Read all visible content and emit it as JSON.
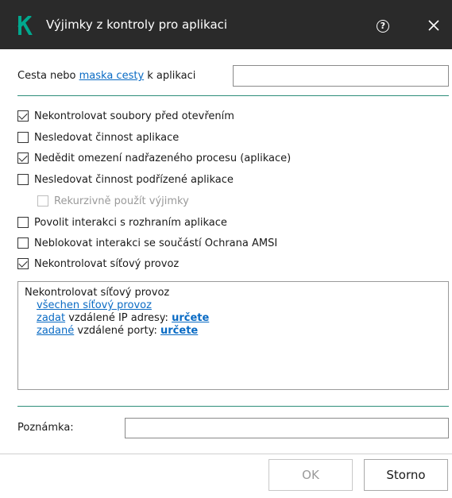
{
  "window": {
    "title": "Výjimky z kontroly pro aplikaci",
    "help_icon": "question-circle-icon",
    "close_icon": "close-icon",
    "logo_icon": "kaspersky-k-logo",
    "brand_color": "#00a88e"
  },
  "path": {
    "label_before": "Cesta nebo ",
    "label_link": "maska cesty",
    "label_after": " k aplikaci",
    "value": ""
  },
  "options": [
    {
      "label": "Nekontrolovat soubory před otevřením",
      "checked": true,
      "disabled": false
    },
    {
      "label": "Nesledovat činnost aplikace",
      "checked": false,
      "disabled": false
    },
    {
      "label": "Nedědit omezení nadřazeného procesu (aplikace)",
      "checked": true,
      "disabled": false
    },
    {
      "label": "Nesledovat činnost podřízené aplikace",
      "checked": false,
      "disabled": false
    },
    {
      "label": "Rekurzivně použít výjimky",
      "checked": false,
      "disabled": true
    },
    {
      "label": "Povolit interakci s rozhraním aplikace",
      "checked": false,
      "disabled": false
    },
    {
      "label": "Neblokovat interakci se součástí Ochrana AMSI",
      "checked": false,
      "disabled": false
    },
    {
      "label": "Nekontrolovat síťový provoz",
      "checked": true,
      "disabled": false
    }
  ],
  "network_panel": {
    "heading": "Nekontrolovat síťový provoz",
    "all_traffic_link": "všechen síťový provoz",
    "ip_link": "zadat",
    "ip_text": " vzdálené IP adresy: ",
    "ip_value_link": "určete",
    "ports_link": "zadané",
    "ports_text": " vzdálené porty: ",
    "ports_value_link": "určete"
  },
  "note": {
    "label": "Poznámka:",
    "value": ""
  },
  "buttons": {
    "ok": "OK",
    "cancel": "Storno"
  }
}
